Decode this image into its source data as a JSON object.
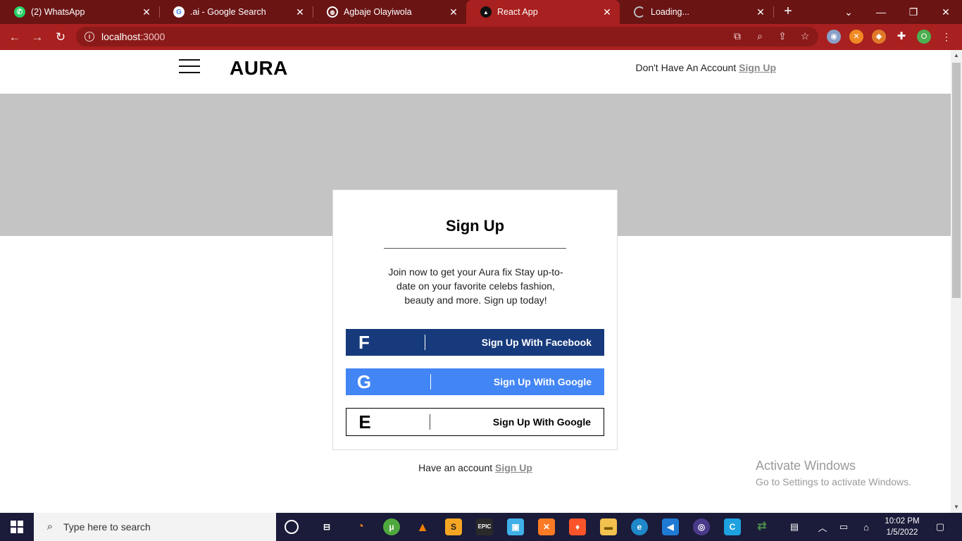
{
  "browser": {
    "tabs": [
      {
        "title": "(2) WhatsApp",
        "icon": "whatsapp-icon",
        "color": "#25d366"
      },
      {
        "title": ".ai - Google Search",
        "icon": "google-icon",
        "color": "#ffffff"
      },
      {
        "title": "Agbaje Olayiwola",
        "icon": "globe-icon",
        "color": "#ffffff"
      },
      {
        "title": "React App",
        "icon": "react-icon",
        "color": "#111111"
      },
      {
        "title": "Loading...",
        "icon": "loading-spinner-icon",
        "color": "#bbbbbb"
      }
    ],
    "url_host": "localhost",
    "url_port": ":3000",
    "profile_initial": "O"
  },
  "header": {
    "logo": "AURA",
    "prompt": "Don't Have An Account",
    "link": "Sign Up"
  },
  "card": {
    "title": "Sign Up",
    "description": "Join now to get your Aura fix Stay up-to-date on your favorite celebs fashion, beauty and more. Sign up today!",
    "buttons": [
      {
        "letter": "F",
        "label": "Sign Up With Facebook",
        "bg": "#163a7c"
      },
      {
        "letter": "G",
        "label": "Sign Up With Google",
        "bg": "#4285f4"
      },
      {
        "letter": "E",
        "label": "Sign Up With Google",
        "bg": "#ffffff"
      }
    ]
  },
  "footer": {
    "prompt": "Have an account",
    "link": "Sign Up"
  },
  "watermark": {
    "line1": "Activate Windows",
    "line2": "Go to Settings to activate Windows."
  },
  "taskbar": {
    "search_placeholder": "Type here to search",
    "time": "10:02 PM",
    "date": "1/5/2022"
  }
}
